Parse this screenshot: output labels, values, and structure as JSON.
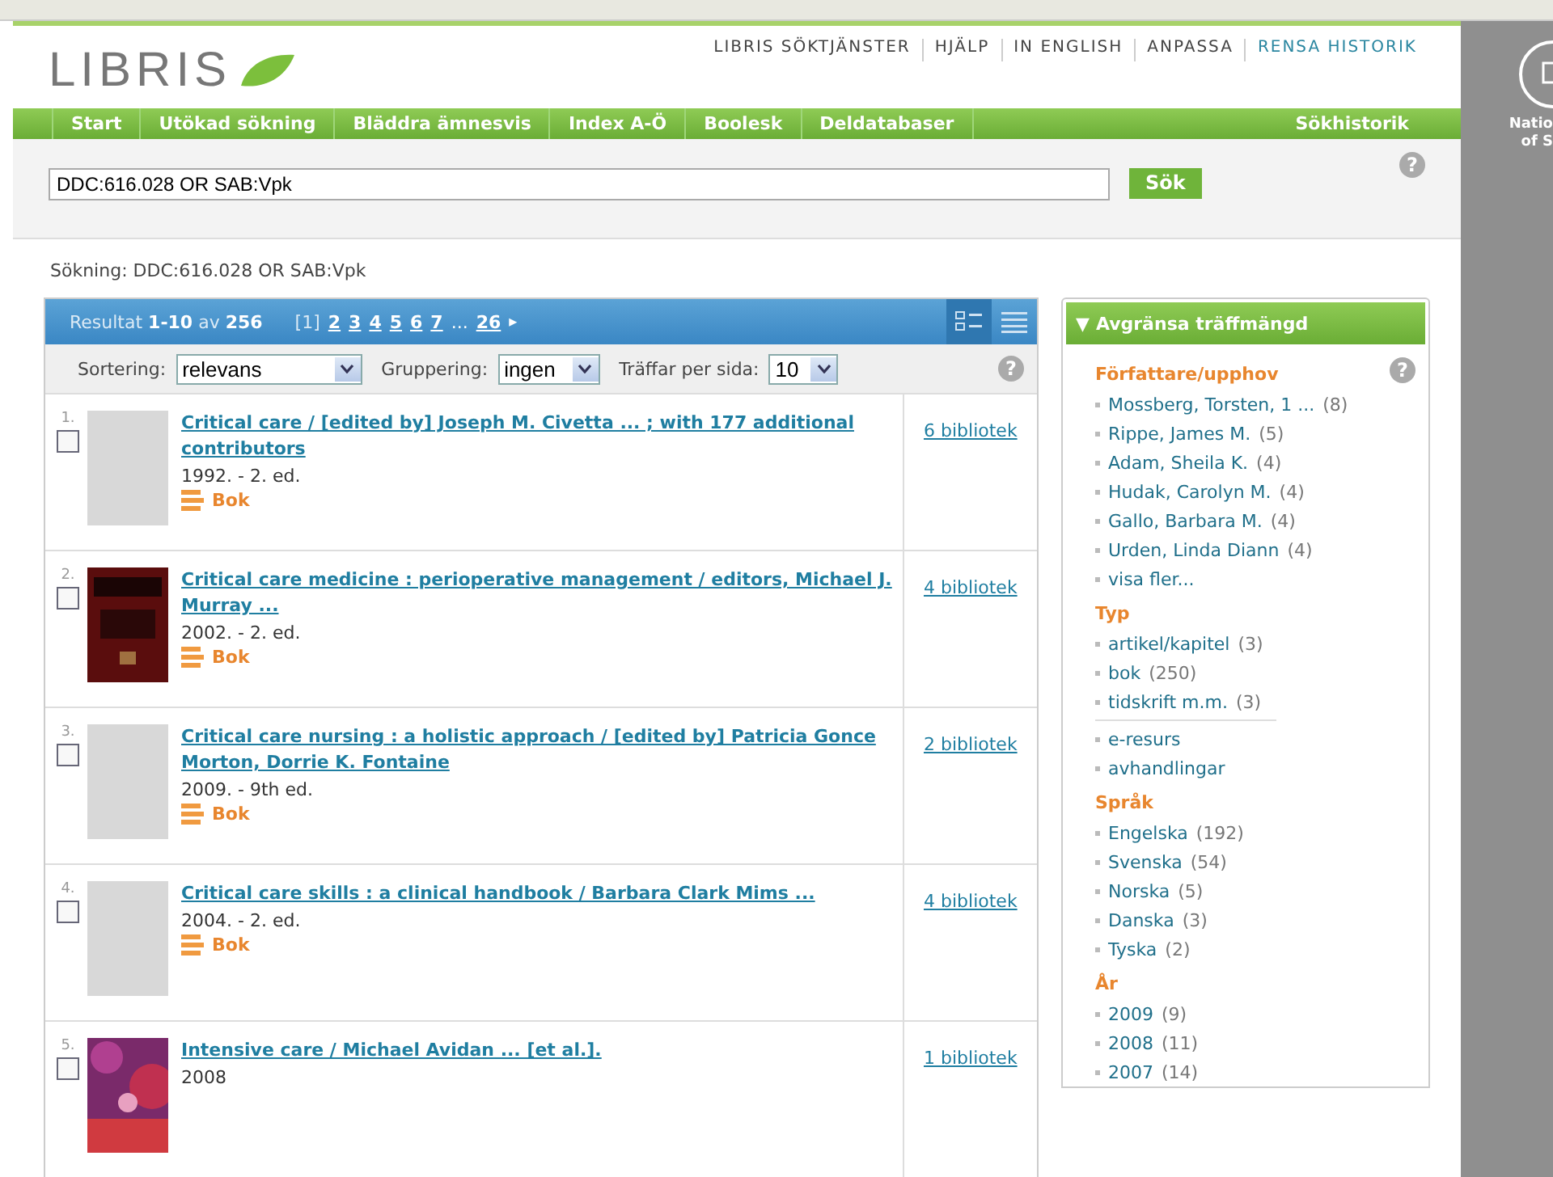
{
  "header": {
    "logo": "LIBRIS",
    "links": [
      {
        "label": "LIBRIS SÖKTJÄNSTER",
        "highlight": false
      },
      {
        "label": "HJÄLP",
        "highlight": false
      },
      {
        "label": "IN ENGLISH",
        "highlight": false
      },
      {
        "label": "ANPASSA",
        "highlight": false
      },
      {
        "label": "RENSA HISTORIK",
        "highlight": true
      }
    ]
  },
  "nav": {
    "items": [
      "Start",
      "Utökad sökning",
      "Bläddra ämnesvis",
      "Index A-Ö",
      "Boolesk",
      "Deldatabaser"
    ],
    "right": "Sökhistorik"
  },
  "search": {
    "value": "DDC:616.028 OR SAB:Vpk",
    "button": "Sök",
    "help": "?"
  },
  "query": "Sökning: DDC:616.028 OR SAB:Vpk",
  "results": {
    "summary": "Resultat **1-10** av **256**",
    "pages": [
      {
        "label": "[1]",
        "selected": true
      },
      {
        "label": "2",
        "selected": false
      },
      {
        "label": "3",
        "selected": false
      },
      {
        "label": "4",
        "selected": false
      },
      {
        "label": "5",
        "selected": false
      },
      {
        "label": "6",
        "selected": false
      },
      {
        "label": "7",
        "selected": false
      },
      {
        "label": "...",
        "kind": "gap",
        "selected": false
      },
      {
        "label": "26",
        "selected": false
      }
    ],
    "next": "▸",
    "view_modes": [
      {
        "kind": "detailed",
        "selected": true
      },
      {
        "kind": "compact",
        "selected": false
      }
    ],
    "sort": {
      "label": "Sortering:",
      "value": "relevans"
    },
    "group": {
      "label": "Gruppering:",
      "value": "ingen"
    },
    "per_page": {
      "label": "Träffar per sida:",
      "value": "10"
    },
    "help": "?",
    "rows": [
      {
        "number": "1.",
        "checked": false,
        "cover_image": false,
        "title": "Critical care / [edited by] Joseph M. Civetta ... ; with 177 additional contributors",
        "meta": "1992. - 2. ed.",
        "type": "Bok",
        "holdings": "6 bibliotek"
      },
      {
        "number": "2.",
        "checked": false,
        "cover_image": true,
        "title": "Critical care medicine : perioperative management / editors, Michael J. Murray ...",
        "meta": "2002. - 2. ed.",
        "type": "Bok",
        "holdings": "4 bibliotek"
      },
      {
        "number": "3.",
        "checked": false,
        "cover_image": false,
        "title": "Critical care nursing : a holistic approach / [edited by] Patricia Gonce Morton, Dorrie K. Fontaine",
        "meta": "2009. - 9th ed.",
        "type": "Bok",
        "holdings": "2 bibliotek"
      },
      {
        "number": "4.",
        "checked": false,
        "cover_image": false,
        "title": "Critical care skills : a clinical handbook / Barbara Clark Mims ...",
        "meta": "2004. - 2. ed.",
        "type": "Bok",
        "holdings": "4 bibliotek"
      },
      {
        "number": "5.",
        "checked": false,
        "cover_image": true,
        "title": "Intensive care / Michael Avidan ... [et al.].",
        "meta": "2008",
        "holdings": "1 bibliotek"
      }
    ]
  },
  "facets": {
    "title": "Avgränsa träffmängd",
    "toggle": "▼",
    "help": "?",
    "groups": [
      {
        "heading": "Författare/upphov",
        "items": [
          {
            "label": "Mossberg, Torsten, 1 ...",
            "count": "(8)",
            "divider_before": false
          },
          {
            "label": "Rippe, James M.",
            "count": "(5)",
            "divider_before": false
          },
          {
            "label": "Adam, Sheila K.",
            "count": "(4)",
            "divider_before": false
          },
          {
            "label": "Hudak, Carolyn M.",
            "count": "(4)",
            "divider_before": false
          },
          {
            "label": "Gallo, Barbara M.",
            "count": "(4)",
            "divider_before": false
          },
          {
            "label": "Urden, Linda Diann",
            "count": "(4)",
            "divider_before": false
          },
          {
            "label": "visa fler...",
            "divider_before": false
          }
        ]
      },
      {
        "heading": "Typ",
        "items": [
          {
            "label": "artikel/kapitel",
            "count": "(3)",
            "divider_before": false
          },
          {
            "label": "bok",
            "count": "(250)",
            "divider_before": false
          },
          {
            "label": "tidskrift m.m.",
            "count": "(3)",
            "divider_before": false
          },
          {
            "label": "e-resurs",
            "divider_before": true
          },
          {
            "label": "avhandlingar",
            "divider_before": false
          }
        ]
      },
      {
        "heading": "Språk",
        "items": [
          {
            "label": "Engelska",
            "count": "(192)",
            "divider_before": false
          },
          {
            "label": "Svenska",
            "count": "(54)",
            "divider_before": false
          },
          {
            "label": "Norska",
            "count": "(5)",
            "divider_before": false
          },
          {
            "label": "Danska",
            "count": "(3)",
            "divider_before": false
          },
          {
            "label": "Tyska",
            "count": "(2)",
            "divider_before": false
          }
        ]
      },
      {
        "heading": "År",
        "items": [
          {
            "label": "2009",
            "count": "(9)",
            "divider_before": false
          },
          {
            "label": "2008",
            "count": "(11)",
            "divider_before": false
          },
          {
            "label": "2007",
            "count": "(14)",
            "divider_before": false
          }
        ]
      }
    ]
  },
  "side_strip": {
    "lines": [
      "Natio",
      "of S"
    ]
  }
}
